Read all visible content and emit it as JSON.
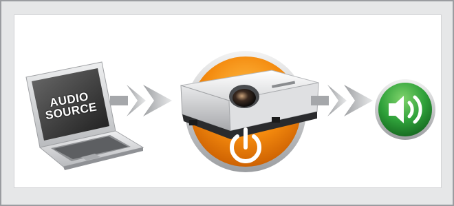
{
  "laptop": {
    "screen_line1": "AUDIO",
    "screen_line2": "SOURCE"
  },
  "icons": {
    "laptop": "laptop-icon",
    "arrow": "double-chevron-arrow-icon",
    "projector": "projector-icon",
    "power": "power-icon",
    "speaker": "speaker-volume-icon"
  },
  "colors": {
    "frame": "#9a9ca0",
    "background": "#e6e7e8",
    "panel": "#ffffff",
    "power_orange": "#f28a10",
    "speaker_green": "#2fa13a"
  }
}
